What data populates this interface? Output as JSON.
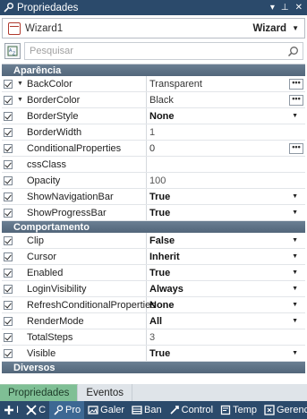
{
  "window": {
    "title": "Propriedades",
    "actions": [
      "▾",
      "⊥",
      "✕"
    ]
  },
  "object_selector": {
    "name": "Wizard1",
    "type": "Wizard"
  },
  "search": {
    "placeholder": "Pesquisar"
  },
  "categories": {
    "appearance": "Aparência",
    "behavior": "Comportamento",
    "misc": "Diversos"
  },
  "appearance_props": [
    {
      "name": "BackColor",
      "value": "Transparent",
      "checked": true,
      "expand": true,
      "editor": "dots"
    },
    {
      "name": "BorderColor",
      "value": "Black",
      "checked": true,
      "expand": true,
      "editor": "dots"
    },
    {
      "name": "BorderStyle",
      "value": "None",
      "checked": true,
      "expand": false,
      "editor": "dropdown"
    },
    {
      "name": "BorderWidth",
      "value": "1",
      "checked": true,
      "expand": false,
      "editor": "none"
    },
    {
      "name": "ConditionalProperties",
      "value": "0",
      "checked": true,
      "expand": false,
      "editor": "dots"
    },
    {
      "name": "cssClass",
      "value": "",
      "checked": true,
      "expand": false,
      "editor": "none"
    },
    {
      "name": "Opacity",
      "value": "100",
      "checked": true,
      "expand": false,
      "editor": "none"
    },
    {
      "name": "ShowNavigationBar",
      "value": "True",
      "checked": true,
      "expand": false,
      "editor": "dropdown"
    },
    {
      "name": "ShowProgressBar",
      "value": "True",
      "checked": true,
      "expand": false,
      "editor": "dropdown"
    }
  ],
  "behavior_props": [
    {
      "name": "Clip",
      "value": "False",
      "checked": true,
      "editor": "dropdown"
    },
    {
      "name": "Cursor",
      "value": "Inherit",
      "checked": true,
      "editor": "dropdown"
    },
    {
      "name": "Enabled",
      "value": "True",
      "checked": true,
      "editor": "dropdown"
    },
    {
      "name": "LoginVisibility",
      "value": "Always",
      "checked": true,
      "editor": "dropdown"
    },
    {
      "name": "RefreshConditionalProperties",
      "value": "None",
      "checked": true,
      "editor": "dropdown"
    },
    {
      "name": "RenderMode",
      "value": "All",
      "checked": true,
      "editor": "dropdown"
    },
    {
      "name": "TotalSteps",
      "value": "3",
      "checked": true,
      "editor": "none"
    },
    {
      "name": "Visible",
      "value": "True",
      "checked": true,
      "editor": "dropdown"
    }
  ],
  "tabs": [
    {
      "label": "Propriedades",
      "active": true
    },
    {
      "label": "Eventos",
      "active": false
    }
  ],
  "bottom_bar": [
    {
      "label": "I",
      "icon": "add-icon"
    },
    {
      "label": "C",
      "icon": "tools-icon"
    },
    {
      "label": "Pro",
      "icon": "properties-icon",
      "selected": true
    },
    {
      "label": "Galer",
      "icon": "gallery-icon"
    },
    {
      "label": "Ban",
      "icon": "database-icon"
    },
    {
      "label": "Control",
      "icon": "control-icon"
    },
    {
      "label": "Temp",
      "icon": "template-icon"
    },
    {
      "label": "Gerenc",
      "icon": "manager-icon"
    }
  ],
  "colors": {
    "titlebar": "#2b4a6b",
    "category_header": "#5f7387",
    "active_tab": "#7fbf95"
  }
}
